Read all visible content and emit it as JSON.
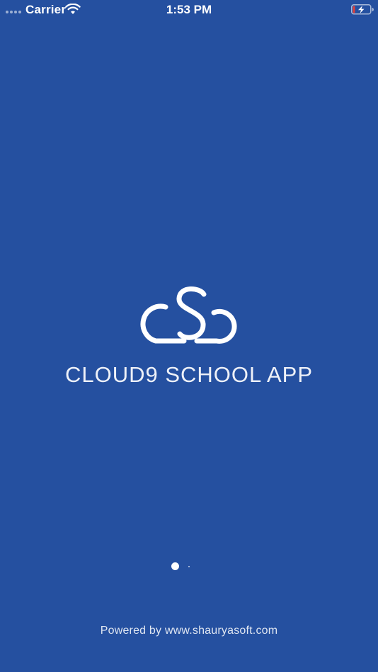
{
  "status_bar": {
    "carrier": "Carrier",
    "time": "1:53 PM",
    "signal_icon": "signal-dots-icon",
    "wifi_icon": "wifi-icon",
    "battery_icon": "battery-charging-icon"
  },
  "splash": {
    "logo_icon": "cloud-csc-logo",
    "title": "CLOUD9 SCHOOL APP",
    "footer": "Powered by www.shauryasoft.com"
  },
  "page_indicator": {
    "current_page": 1,
    "total_pages": 2
  },
  "colors": {
    "background": "#2550a0",
    "foreground": "#ffffff",
    "battery_low": "#e0403a"
  }
}
